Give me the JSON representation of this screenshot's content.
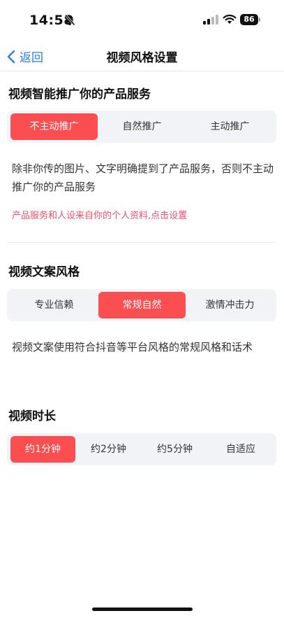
{
  "status": {
    "time": "14:58",
    "battery": "86"
  },
  "nav": {
    "back_label": "返回",
    "title": "视频风格设置"
  },
  "promo": {
    "title": "视频智能推广你的产品服务",
    "options": [
      "不主动推广",
      "自然推广",
      "主动推广"
    ],
    "selected": "不主动推广",
    "description": "除非你传的图片、文字明确提到了产品服务，否则不主动推广你的产品服务",
    "hint_text": "产品服务和人设来自你的个人资料,",
    "hint_link": "点击设置"
  },
  "copy_style": {
    "title": "视频文案风格",
    "options": [
      "专业信赖",
      "常规自然",
      "激情冲击力"
    ],
    "selected": "常规自然",
    "description": "视频文案使用符合抖音等平台风格的常规风格和话术"
  },
  "duration": {
    "title": "视频时长",
    "options": [
      "约1分钟",
      "约2分钟",
      "约5分钟",
      "自适应"
    ],
    "selected": "约1分钟"
  },
  "colors": {
    "accent": "#fb4e50",
    "link": "#2b7de9",
    "hint": "#f2506a",
    "segment_bg": "#f2f3f7"
  }
}
